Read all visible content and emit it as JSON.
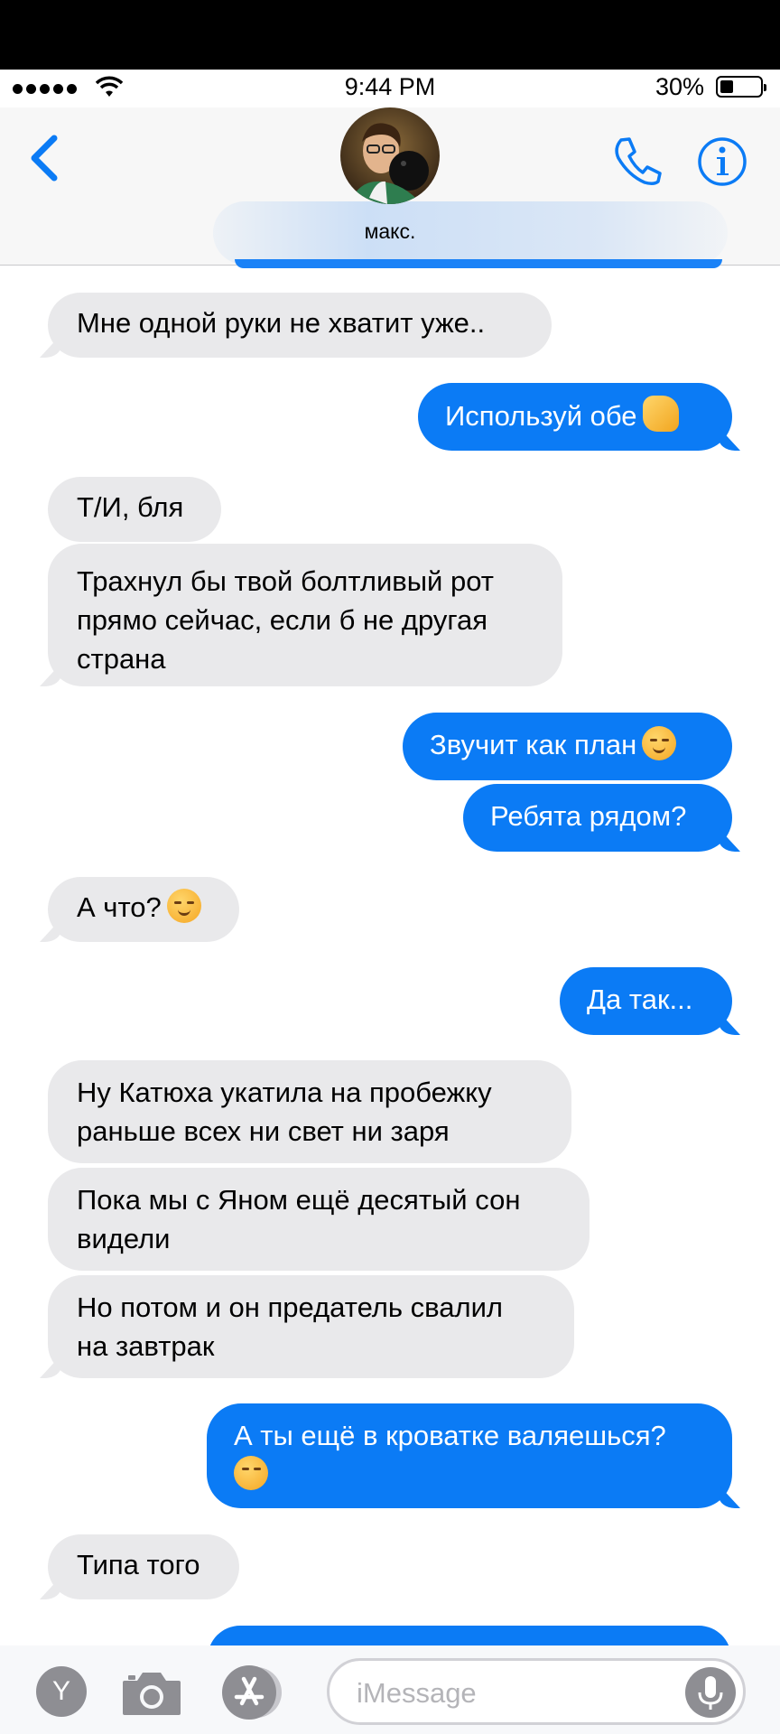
{
  "status_bar": {
    "time": "9:44 PM",
    "battery": "30%",
    "battery_level": 0.3,
    "signal_bars": 5
  },
  "header": {
    "contact_name": "макс.",
    "back_icon": "chevron-left-icon",
    "call_icon": "phone-icon",
    "info_icon": "info-icon"
  },
  "messages": [
    {
      "dir": "in",
      "text": "Мне одной руки не хватит уже.."
    },
    {
      "dir": "out",
      "text": "Используй обе",
      "emoji": "call-me-hand-emoji"
    },
    {
      "dir": "in",
      "text": "Т/И, бля"
    },
    {
      "dir": "in",
      "lines": [
        "Трахнул бы твой болтливый рот",
        "прямо сейчас, если б не другая",
        "страна"
      ]
    },
    {
      "dir": "out",
      "text": "Звучит как план",
      "emoji": "drooling-face-emoji"
    },
    {
      "dir": "out",
      "text": "Ребята рядом?"
    },
    {
      "dir": "in",
      "text": "А что?",
      "emoji": "smirking-face-emoji"
    },
    {
      "dir": "out",
      "text": "Да так..."
    },
    {
      "dir": "in",
      "lines": [
        "Ну Катюха укатила на пробежку",
        "раньше всех ни свет ни заря"
      ]
    },
    {
      "dir": "in",
      "lines": [
        "Пока мы с Яном ещё десятый сон",
        "видели"
      ]
    },
    {
      "dir": "in",
      "lines": [
        "Но потом и он предатель свалил",
        "на завтрак"
      ]
    },
    {
      "dir": "out",
      "lines": [
        "А ты ещё в кроватке валяешься?"
      ],
      "emoji": "face-with-hand-over-mouth-emoji"
    },
    {
      "dir": "in",
      "text": "Типа того"
    }
  ],
  "input_bar": {
    "placeholder": "iMessage",
    "y_button": "Y",
    "camera_icon": "camera-icon",
    "apps_icon": "app-store-icon",
    "mic_icon": "microphone-icon"
  }
}
